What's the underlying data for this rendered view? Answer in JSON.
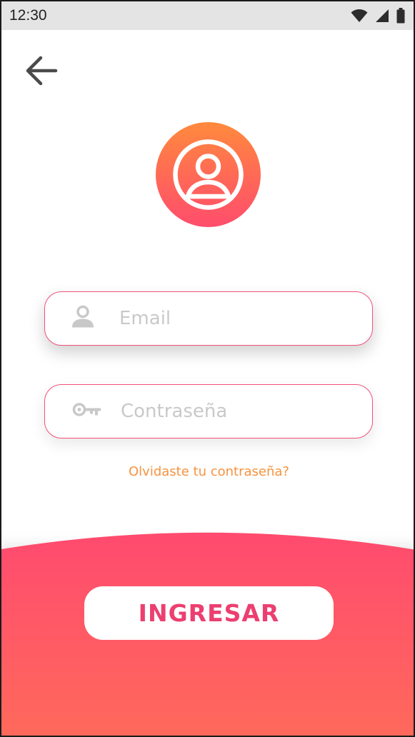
{
  "status_bar": {
    "time": "12:30"
  },
  "colors": {
    "accent": "#f0517a",
    "orange": "#f7933f",
    "gradient_top": "#ff4d6d",
    "gradient_bottom": "#ff6a55",
    "button_text": "#ec3f70"
  },
  "icons": {
    "back": "arrow-left-icon",
    "avatar": "user-circle-icon",
    "email": "person-icon",
    "password": "key-icon"
  },
  "form": {
    "email": {
      "placeholder": "Email",
      "value": ""
    },
    "password": {
      "placeholder": "Contraseña",
      "value": ""
    },
    "forgot_link": "Olvidaste tu contraseña?"
  },
  "actions": {
    "login_label": "INGRESAR"
  }
}
